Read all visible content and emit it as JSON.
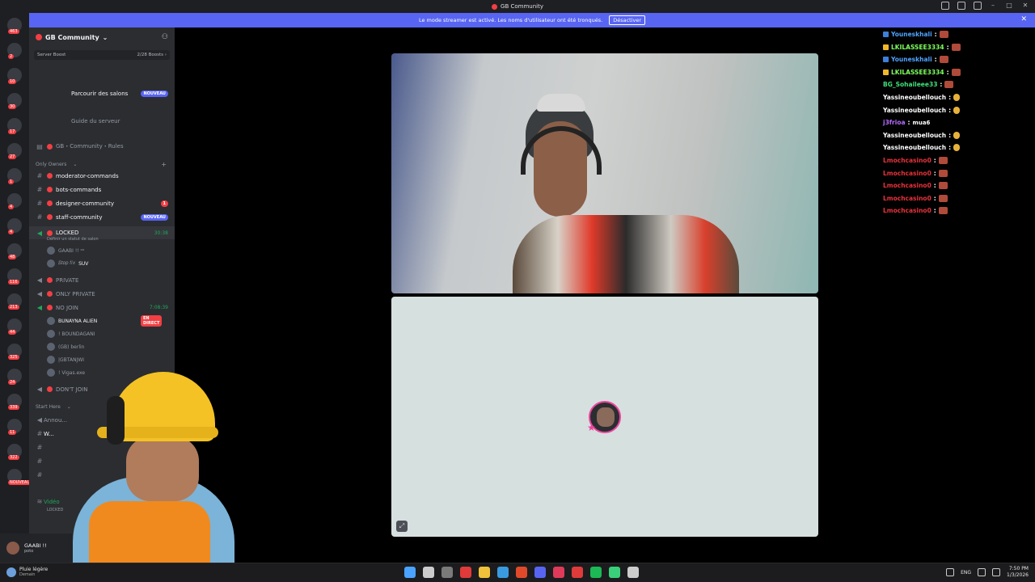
{
  "window": {
    "title": "GB Community"
  },
  "streamer_banner": {
    "text": "Le mode streamer est activé. Les noms d'utilisateur ont été tronqués.",
    "button": "Désactiver",
    "close": "✕"
  },
  "server_badges": [
    "463",
    "2",
    "10",
    "30",
    "17",
    "27",
    "1",
    "4",
    "4",
    "48",
    "116",
    "213",
    "44",
    "325",
    "24",
    "339",
    "11",
    "322",
    "NOUVEAU"
  ],
  "guild": {
    "name": "GB Community",
    "chevron": "⌄"
  },
  "boost": {
    "label": "Server Boost",
    "value": "2/28 Boosts",
    "arrow": "›"
  },
  "top_items": {
    "browse": "Parcourir des salons",
    "browse_badge": "NOUVEAU",
    "guide": "Guide du serveur"
  },
  "channels": [
    {
      "name": "GB・Community・Rules",
      "kind": "text"
    },
    {
      "category": "Only Owners",
      "kind": "category"
    },
    {
      "name": "moderator-commands",
      "kind": "text"
    },
    {
      "name": "bots-commands",
      "kind": "text"
    },
    {
      "name": "designer-community",
      "kind": "text",
      "badge": "1"
    },
    {
      "name": "staff-community",
      "kind": "text",
      "badge_new": "NOUVEAU"
    },
    {
      "name": "LOCKED",
      "kind": "voice",
      "timer": "30:38",
      "status": "Définir un statut de salon"
    }
  ],
  "locked_members": [
    {
      "name": "GAABI !! ᵒᵒ"
    },
    {
      "name": "𝑆𝑡𝑜𝑝 𝑓𝑖𝑥",
      "tag": "SUV"
    }
  ],
  "voice_channels": [
    {
      "name": "PRIVATE"
    },
    {
      "name": "ONLY PRIVATE"
    },
    {
      "name": "NO JOIN",
      "timer": "7:08:39"
    }
  ],
  "nojoin_members": [
    {
      "name": "BUNAYNA ALIEN",
      "live": "EN DIRECT"
    },
    {
      "name": "! BOUNDAGANI"
    },
    {
      "name": "(GB) berlin"
    },
    {
      "name": "|GBTANJWI"
    },
    {
      "name": "! Vigas.exe"
    }
  ],
  "dont_join": "DON'T JOIN",
  "start_here": "Start Here",
  "lower_partial": [
    "Annou...",
    "W..."
  ],
  "voice_partial": {
    "label": "Vidéo",
    "sub": "LOCKED"
  },
  "user_panel": {
    "name": "GAABI !!",
    "sub": "poto"
  },
  "chat": [
    {
      "user": "Youneskhali",
      "color": "#4fa3ff",
      "badge": "#3d7fd9",
      "emote": "box"
    },
    {
      "user": "LKILASSEE3334",
      "color": "#7cff5b",
      "badge": "#f0b829",
      "emote": "box"
    },
    {
      "user": "Youneskhali",
      "color": "#4fa3ff",
      "badge": "#3d7fd9",
      "emote": "box"
    },
    {
      "user": "LKILASSEE3334",
      "color": "#7cff5b",
      "badge": "#f0b829",
      "emote": "box"
    },
    {
      "user": "BG_Sohaileee33",
      "color": "#3ee07a",
      "emote": "box"
    },
    {
      "user": "Yassineoubellouch",
      "color": "#ffffff",
      "emote": "hand"
    },
    {
      "user": "Yassineoubellouch",
      "color": "#ffffff",
      "emote": "hand"
    },
    {
      "user": "j3frioa",
      "color": "#b46bff",
      "msg": "mua6"
    },
    {
      "user": "Yassineoubellouch",
      "color": "#ffffff",
      "emote": "hand"
    },
    {
      "user": "Yassineoubellouch",
      "color": "#ffffff",
      "emote": "hand"
    },
    {
      "user": "Lmochcasino0",
      "color": "#e8323a",
      "emote": "box"
    },
    {
      "user": "Lmochcasino0",
      "color": "#e8323a",
      "emote": "box"
    },
    {
      "user": "Lmochcasino0",
      "color": "#e8323a",
      "emote": "box"
    },
    {
      "user": "Lmochcasino0",
      "color": "#e8323a",
      "emote": "box"
    },
    {
      "user": "Lmochcasino0",
      "color": "#e8323a",
      "emote": "box"
    }
  ],
  "taskbar": {
    "weather": "Pluie légère",
    "weather_sub": "Demain",
    "lang": "ENG",
    "time": "7:50 PM",
    "date": "1/3/2026",
    "icon_colors": [
      "#4aa3ff",
      "#cccccc",
      "#7a7a7a",
      "#e03a3a",
      "#f0c23a",
      "#3a9ae0",
      "#e04a2a",
      "#5865f2",
      "#e03a5a",
      "#e03a3a",
      "#1db954",
      "#3ad07a",
      "#cccccc"
    ]
  }
}
